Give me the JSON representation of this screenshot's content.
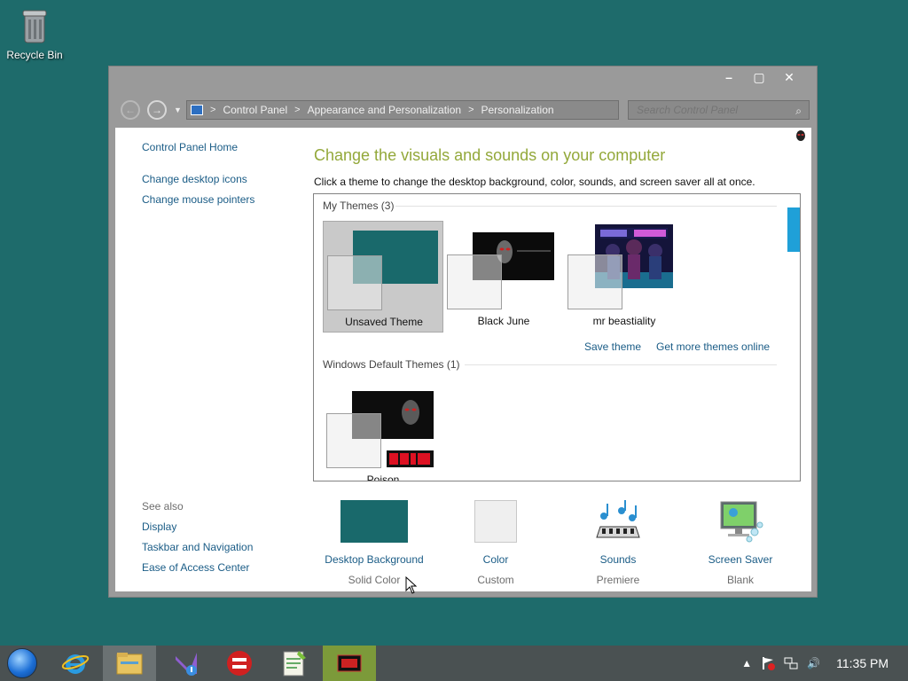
{
  "desktop": {
    "recycle_bin_label": "Recycle Bin"
  },
  "window": {
    "controls": {
      "minimize": "–",
      "maximize": "▢",
      "close": "✕"
    },
    "address": {
      "crumbs": [
        "Control Panel",
        "Appearance and Personalization",
        "Personalization"
      ],
      "separator": ">"
    },
    "search": {
      "placeholder": "Search Control Panel"
    }
  },
  "sidebar": {
    "home": "Control Panel Home",
    "links": [
      "Change desktop icons",
      "Change mouse pointers"
    ],
    "see_also_heading": "See also",
    "see_also": [
      "Display",
      "Taskbar and Navigation",
      "Ease of Access Center"
    ]
  },
  "main": {
    "title": "Change the visuals and sounds on your computer",
    "description": "Click a theme to change the desktop background, color, sounds, and screen saver all at once."
  },
  "themes": {
    "my_themes_header": "My Themes (3)",
    "my_themes": [
      {
        "name": "Unsaved Theme",
        "selected": true
      },
      {
        "name": "Black June",
        "selected": false
      },
      {
        "name": "mr beastiality",
        "selected": false
      }
    ],
    "save_theme": "Save theme",
    "get_more": "Get more themes online",
    "default_header": "Windows Default Themes (1)",
    "default_themes": [
      {
        "name": "Poison"
      }
    ]
  },
  "bottom": [
    {
      "label": "Desktop Background",
      "sub": "Solid Color",
      "color": "#19696b"
    },
    {
      "label": "Color",
      "sub": "Custom",
      "color": "#efefef"
    },
    {
      "label": "Sounds",
      "sub": "Premiere"
    },
    {
      "label": "Screen Saver",
      "sub": "Blank"
    }
  ],
  "taskbar": {
    "apps": [
      "internet-explorer",
      "file-explorer",
      "visual-studio",
      "dev-cpp",
      "notepad-plus-plus",
      "media-app"
    ],
    "clock": "11:35 PM"
  },
  "colors": {
    "desktop": "#1e6b6b",
    "title_green": "#93a83a",
    "link_blue": "#1a5c86",
    "accent_blue": "#1fa0d8"
  }
}
